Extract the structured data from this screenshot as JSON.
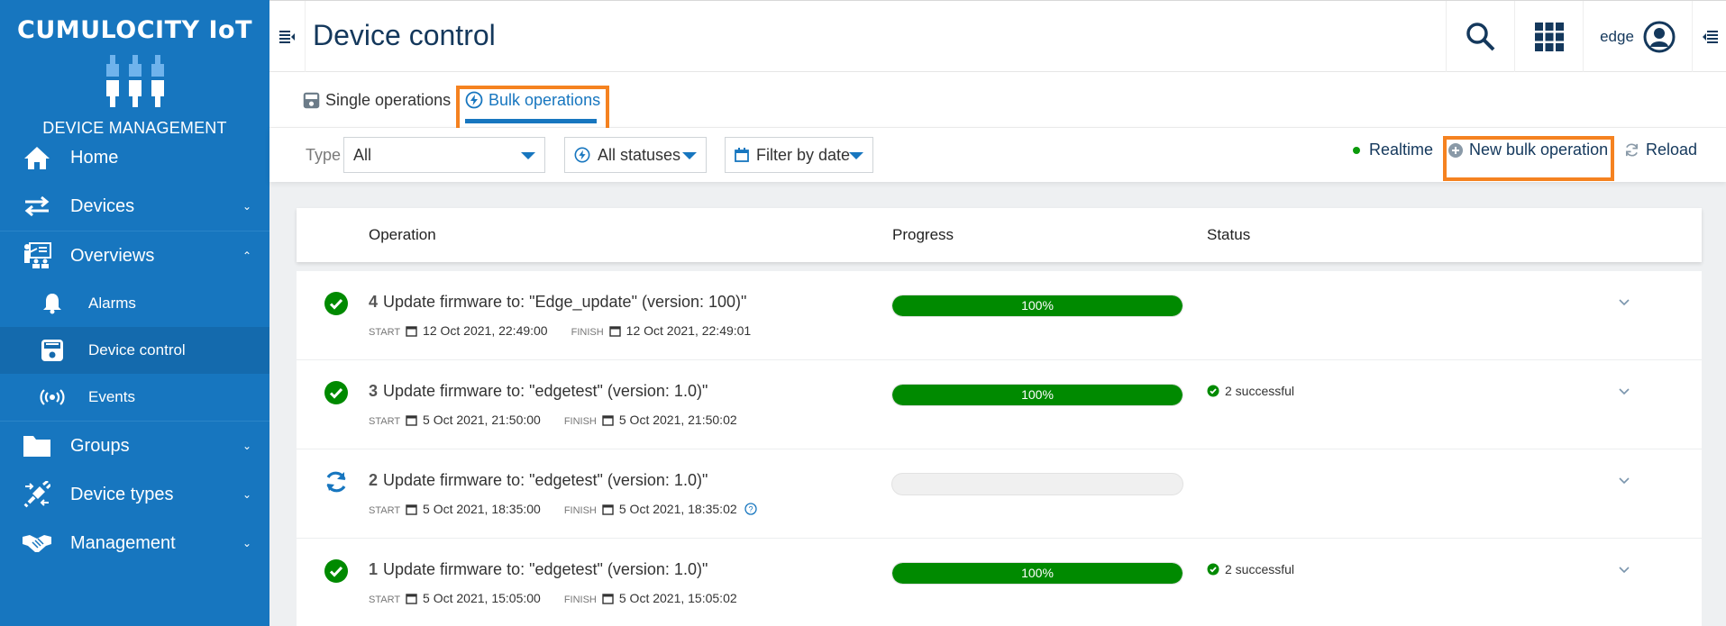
{
  "sidebar": {
    "brand_title": "CUMULOCITY IoT",
    "brand_subtitle": "DEVICE MANAGEMENT",
    "items": [
      {
        "label": "Home",
        "icon": "home-icon"
      },
      {
        "label": "Devices",
        "icon": "arrows-exchange-icon",
        "chevron": "⌄"
      },
      {
        "label": "Overviews",
        "icon": "presentation-icon",
        "chevron": "⌃",
        "expanded": true,
        "children": [
          {
            "label": "Alarms",
            "icon": "bell-icon"
          },
          {
            "label": "Device control",
            "icon": "device-control-icon",
            "active": true
          },
          {
            "label": "Events",
            "icon": "broadcast-icon"
          }
        ]
      },
      {
        "label": "Groups",
        "icon": "folder-icon",
        "chevron": "⌄"
      },
      {
        "label": "Device types",
        "icon": "plug-icon",
        "chevron": "⌄"
      },
      {
        "label": "Management",
        "icon": "handshake-icon",
        "chevron": "⌄"
      }
    ]
  },
  "header": {
    "title": "Device control",
    "user": "edge"
  },
  "tabs": [
    {
      "label": "Single operations",
      "icon": "device-control-icon",
      "active": false
    },
    {
      "label": "Bulk operations",
      "icon": "bolt-circle-icon",
      "active": true
    }
  ],
  "toolbar": {
    "type_label": "Type",
    "type_value": "All",
    "status_filter": "All statuses",
    "date_filter": "Filter by date",
    "realtime_label": "Realtime",
    "new_bulk_label": "New bulk operation",
    "reload_label": "Reload"
  },
  "table": {
    "columns": [
      "Operation",
      "Progress",
      "Status"
    ],
    "start_label": "START",
    "finish_label": "FINISH",
    "rows": [
      {
        "id": "4",
        "title": "Update firmware to: \"Edge_update\" (version: 100)\"",
        "state": "success",
        "start": "12 Oct 2021, 22:49:00",
        "finish": "12 Oct 2021, 22:49:01",
        "progress": 100,
        "progress_label": "100%",
        "status": ""
      },
      {
        "id": "3",
        "title": "Update firmware to: \"edgetest\" (version: 1.0)\"",
        "state": "success",
        "start": "5 Oct 2021, 21:50:00",
        "finish": "5 Oct 2021, 21:50:02",
        "progress": 100,
        "progress_label": "100%",
        "status": "2 successful"
      },
      {
        "id": "2",
        "title": "Update firmware to: \"edgetest\" (version: 1.0)\"",
        "state": "in-progress",
        "start": "5 Oct 2021, 18:35:00",
        "finish": "5 Oct 2021, 18:35:02",
        "progress": 0,
        "progress_label": "",
        "status": "",
        "help": true
      },
      {
        "id": "1",
        "title": "Update firmware to: \"edgetest\" (version: 1.0)\"",
        "state": "success",
        "start": "5 Oct 2021, 15:05:00",
        "finish": "5 Oct 2021, 15:05:02",
        "progress": 100,
        "progress_label": "100%",
        "status": "2 successful"
      }
    ]
  },
  "colors": {
    "sidebar": "#1776bf",
    "accent": "#1776bf",
    "success": "#008a00",
    "highlight": "#f58220",
    "title": "#14385c"
  }
}
